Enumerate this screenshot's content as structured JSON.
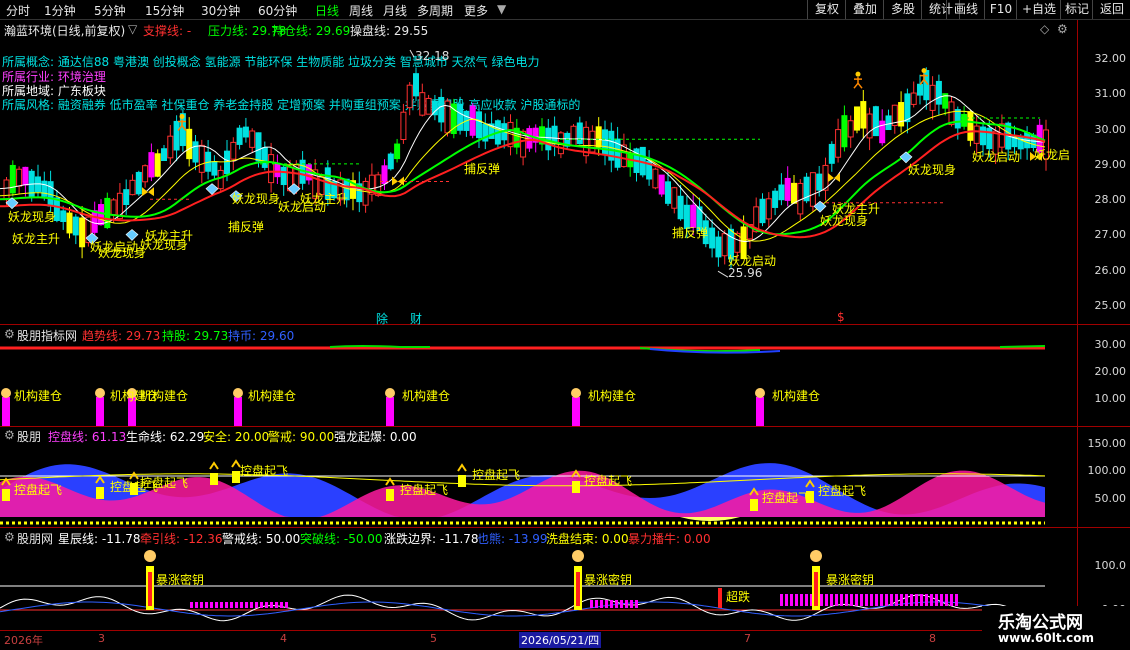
{
  "toolbar": {
    "timeframes": [
      {
        "label": "分时",
        "active": false
      },
      {
        "label": "1分钟",
        "active": false
      },
      {
        "label": "5分钟",
        "active": false
      },
      {
        "label": "15分钟",
        "active": false
      },
      {
        "label": "30分钟",
        "active": false
      },
      {
        "label": "60分钟",
        "active": false
      },
      {
        "label": "日线",
        "active": true
      },
      {
        "label": "周线",
        "active": false
      },
      {
        "label": "月线",
        "active": false
      },
      {
        "label": "多周期",
        "active": false
      },
      {
        "label": "更多",
        "active": false
      }
    ],
    "right_buttons": [
      "复权",
      "叠加",
      "多股",
      "统计",
      "画线",
      "F10",
      "+自选",
      "标记",
      "返回"
    ]
  },
  "main": {
    "stock_title": "瀚蓝环境(日线,前复权)",
    "support_label": "支撑线: -",
    "pressure_label": "压力线: 29.78",
    "position_line_label": "持仓线: 29.69",
    "operate_line_label": "操盘线: 29.55",
    "concept_line": "所属概念: 通达信88 粤港澳 创投概念 氢能源 节能环保 生物质能 垃圾分类 智慧城市 天然气 绿色电力",
    "industry_line": "所属行业: 环境治理",
    "region_line": "所属地域: 广东板块",
    "style_line": "所属风格: 融资融券 低市盈率 社保重仓 养老金持股 定增预案 并购重组预案 并购重组股 高应收款 沪股通标的",
    "high_label": "32.18",
    "low_label": "25.96",
    "y_ticks": [
      "32.00",
      "31.00",
      "30.00",
      "29.00",
      "28.00",
      "27.00",
      "26.00",
      "25.00"
    ],
    "event_markers": [
      "除",
      "财",
      "$"
    ],
    "signals": [
      "妖龙现身",
      "妖龙主升",
      "妖龙启动",
      "妖龙现身",
      "妖龙主升",
      "妖龙现身",
      "捕反弹",
      "妖龙现身",
      "妖龙启动",
      "妖龙主升",
      "捕反弹",
      "捕反弹",
      "妖龙启动",
      "妖龙主升",
      "妖龙现身",
      "妖龙现身",
      "妖龙启动",
      "妖龙启"
    ]
  },
  "panel1": {
    "title": "股朋指标网",
    "trend_label": "趋势线: 29.73",
    "hold_label": "持股: 29.73",
    "hold_coin_label": "持币: 29.60",
    "y_ticks": [
      "30.00",
      "20.00",
      "10.00"
    ],
    "signals": [
      "机构建仓",
      "机构建仓",
      "机构建仓",
      "机构建仓",
      "机构建仓",
      "机构建仓"
    ]
  },
  "panel2": {
    "title": "股朋",
    "control_label": "控盘线: 61.13",
    "life_label": "生命线: 62.29",
    "safe_label": "安全: 20.00",
    "alert_label": "警戒: 90.00",
    "strong_label": "强龙起爆: 0.00",
    "y_ticks": [
      "150.00",
      "100.00",
      "50.00"
    ],
    "signals": [
      "控盘起飞",
      "控盘起飞",
      "控盘起飞",
      "控盘起飞",
      "控盘起飞",
      "控盘起飞",
      "控盘起飞",
      "控盘起飞"
    ]
  },
  "panel3": {
    "title": "股朋网",
    "star_label": "星辰线: -11.78",
    "pull_label": "牵引线: -12.36",
    "warn_label": "警戒线: 50.00",
    "break_label": "突破线: -50.00",
    "boundary_label": "涨跌边界: -11.78",
    "bear_label": "也熊: -13.99",
    "wash_label": "洗盘结束: 0.00",
    "bull_label": "暴力播牛: 0.00",
    "y_ticks": [
      "100.0",
      "0.00"
    ],
    "signals": [
      "暴涨密钥",
      "暴涨密钥",
      "超跌",
      "暴涨密钥"
    ]
  },
  "dates": [
    "2026年",
    "3",
    "4",
    "5",
    "2026/05/21/四",
    "7",
    "8"
  ],
  "watermark": {
    "title": "乐淘公式网",
    "url": "www.60lt.com"
  },
  "colors": {
    "up": "#ff3030",
    "down": "#00e0e0",
    "yellow": "#ffff00",
    "magenta": "#ff00ff",
    "green": "#00ff00",
    "grid": "#a00000"
  }
}
